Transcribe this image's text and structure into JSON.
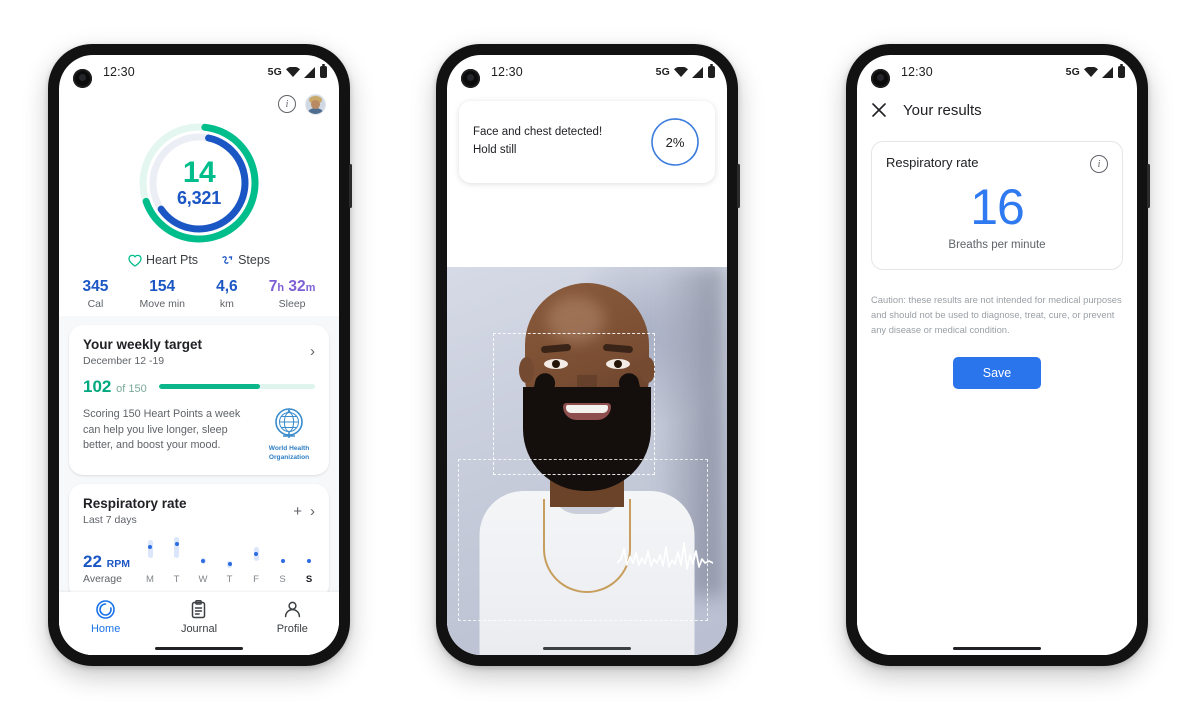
{
  "status_bar": {
    "time": "12:30",
    "network": "5G",
    "icons": [
      "wifi-icon",
      "signal-icon",
      "battery-icon"
    ]
  },
  "phone1": {
    "header": {
      "info_icon": "info-icon",
      "avatar": "avatar"
    },
    "rings": {
      "heart_points": "14",
      "steps": "6,321",
      "heart_points_color": "#00bd8c",
      "steps_color": "#1a56c4",
      "heart_points_pct": 68,
      "steps_pct": 62
    },
    "legend": [
      {
        "label": "Heart Pts",
        "icon": "heart-icon"
      },
      {
        "label": "Steps",
        "icon": "steps-icon"
      }
    ],
    "stats": [
      {
        "value": "345",
        "unit": "",
        "label": "Cal",
        "color": "#1a56c4"
      },
      {
        "value": "154",
        "unit": "",
        "label": "Move min",
        "color": "#1a56c4"
      },
      {
        "value": "4,6",
        "unit": "",
        "label": "km",
        "color": "#1a56c4"
      },
      {
        "value": "7",
        "unit": "h",
        "value2": "32",
        "unit2": "m",
        "label": "Sleep",
        "color": "#7d60d6"
      }
    ],
    "weekly_target": {
      "title": "Your weekly target",
      "date_range": "December 12 -19",
      "current": "102",
      "goal": "of 150",
      "progress_pct": 65,
      "description": "Scoring 150 Heart Points a week can help you live longer, sleep better, and boost your mood.",
      "who_logo_line1": "World Health",
      "who_logo_line2": "Organization",
      "chevron": "chevron-right-icon"
    },
    "respiratory": {
      "title": "Respiratory rate",
      "subtitle": "Last 7 days",
      "average": "22",
      "average_unit": "RPM",
      "average_label": "Average",
      "add_icon": "plus-icon",
      "chevron": "chevron-right-icon"
    },
    "nav": [
      {
        "label": "Home",
        "icon": "home-rings-icon",
        "active": true
      },
      {
        "label": "Journal",
        "icon": "clipboard-icon",
        "active": false
      },
      {
        "label": "Profile",
        "icon": "person-icon",
        "active": false
      }
    ]
  },
  "phone2": {
    "detection_card": {
      "line1": "Face and chest detected!",
      "line2": "Hold still",
      "progress_percent": "2%",
      "progress_value": 2
    },
    "camera": {
      "face_box": "face-detection-box",
      "chest_box": "chest-detection-box",
      "waveform": "breathing-waveform"
    }
  },
  "phone3": {
    "header": {
      "close_icon": "close-icon",
      "title": "Your results"
    },
    "result_card": {
      "title": "Respiratory rate",
      "info_icon": "info-icon",
      "value": "16",
      "unit": "Breaths per minute",
      "value_color": "#2f7af0"
    },
    "caution": "Caution: these results are not intended for medical purposes and should not be used to diagnose, treat, cure, or prevent any disease or medical condition.",
    "save_label": "Save",
    "save_color": "#2a74ec"
  },
  "chart_data": {
    "type": "scatter",
    "title": "Respiratory rate",
    "subtitle": "Last 7 days",
    "ylabel": "RPM",
    "categories": [
      "M",
      "T",
      "W",
      "T",
      "F",
      "S",
      "S"
    ],
    "values": [
      24,
      25,
      20,
      19,
      22,
      20,
      20
    ],
    "ranges": [
      [
        21,
        26
      ],
      [
        21,
        27
      ],
      [
        19,
        21
      ],
      [
        18,
        20
      ],
      [
        20,
        24
      ],
      [
        20,
        20
      ],
      [
        20,
        20
      ]
    ],
    "average": 22,
    "highlight_index": 6,
    "dot_color": "#2c6ce0",
    "band_color": "#dbe6fb"
  }
}
